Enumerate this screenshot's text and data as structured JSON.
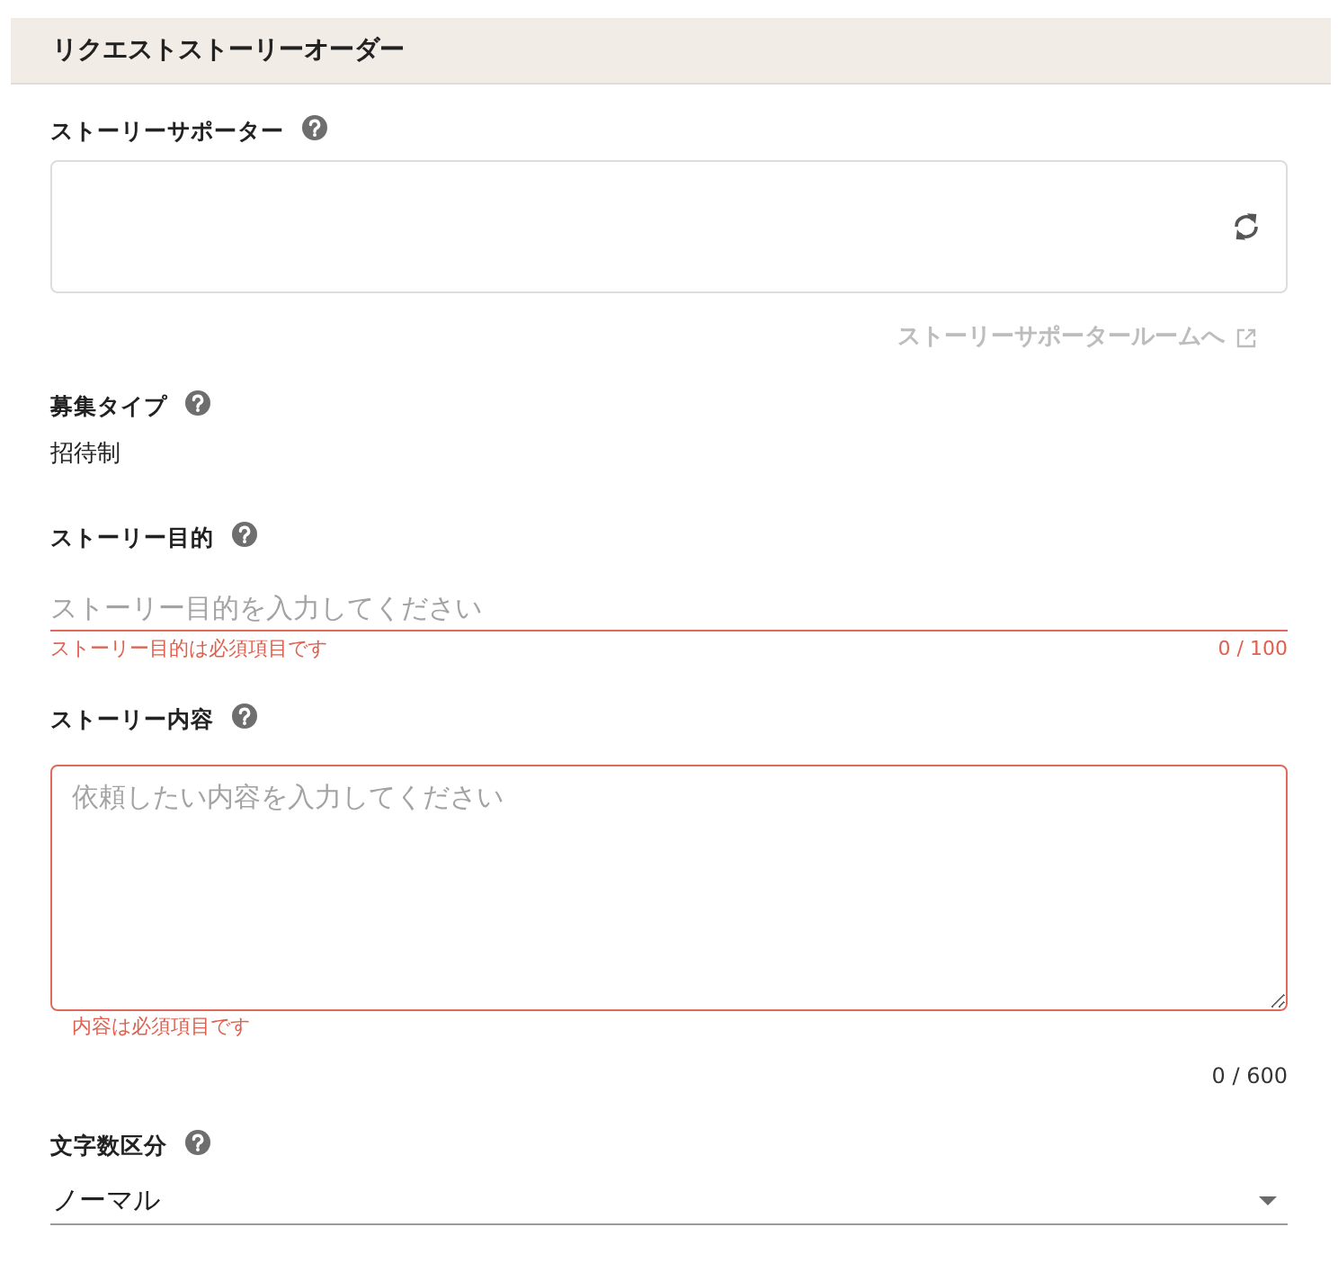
{
  "header": {
    "title": "リクエストストーリーオーダー"
  },
  "fields": [
    {
      "kind": "picker",
      "label": "ストーリーサポーター",
      "link": {
        "label": "ストーリーサポータールームへ",
        "disabled": true
      }
    },
    {
      "kind": "static",
      "label": "募集タイプ",
      "value": "招待制"
    },
    {
      "kind": "text",
      "label": "ストーリー目的",
      "placeholder": "ストーリー目的を入力してください",
      "invalid": true,
      "error": "ストーリー目的は必須項目です",
      "counter": "0 / 100"
    },
    {
      "kind": "textarea",
      "label": "ストーリー内容",
      "placeholder": "依頼したい内容を入力してください",
      "invalid": true,
      "error": "内容は必須項目です",
      "counter": "0 / 600"
    },
    {
      "kind": "select",
      "label": "文字数区分",
      "value": "ノーマル"
    }
  ]
}
